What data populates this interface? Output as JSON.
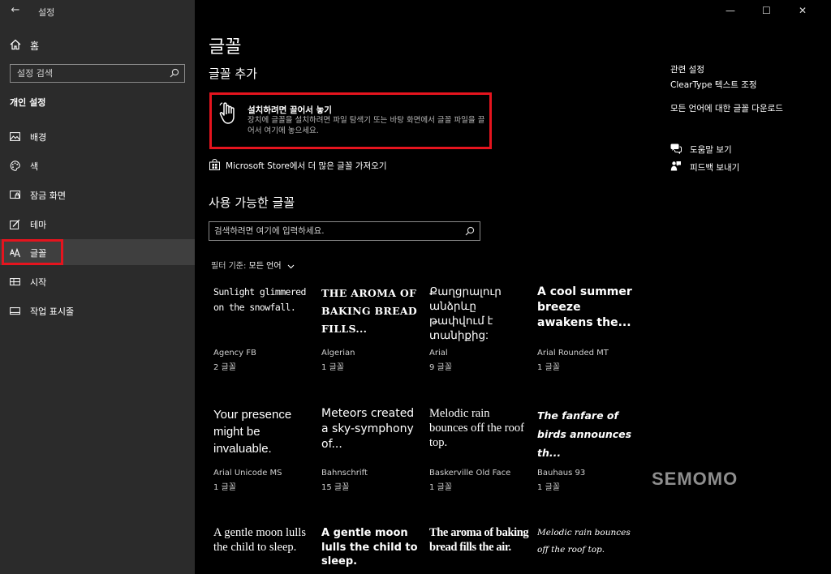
{
  "titlebar": {
    "title": "설정",
    "back_glyph": "←"
  },
  "sidebar": {
    "home_label": "홈",
    "search": {
      "placeholder": "설정 검색"
    },
    "section_title": "개인 설정",
    "items": [
      {
        "label": "배경",
        "icon": "image-icon"
      },
      {
        "label": "색",
        "icon": "palette-icon"
      },
      {
        "label": "잠금 화면",
        "icon": "lock-screen-icon"
      },
      {
        "label": "테마",
        "icon": "theme-icon"
      },
      {
        "label": "글꼴",
        "icon": "font-icon",
        "active": true
      },
      {
        "label": "시작",
        "icon": "start-icon"
      },
      {
        "label": "작업 표시줄",
        "icon": "taskbar-icon"
      }
    ]
  },
  "window_controls": {
    "minimize": "—",
    "maximize": "☐",
    "close": "✕"
  },
  "main": {
    "title": "글꼴",
    "add_fonts_heading": "글꼴 추가",
    "drop_zone": {
      "title": "설치하려면 끌어서 놓기",
      "description": "장치에 글꼴을 설치하려면 파일 탐색기 또는 바탕 화면에서 글꼴 파일을 끌어서 여기에 놓으세요."
    },
    "store_link": "Microsoft Store에서 더 많은 글꼴 가져오기",
    "available_heading": "사용 가능한 글꼴",
    "font_search": {
      "placeholder": "검색하려면 여기에 입력하세요."
    },
    "filter": {
      "label": "필터 기준:",
      "value": "모든 언어"
    },
    "fonts": [
      {
        "sample": "Sunlight glimmered on the snowfall.",
        "name": "Agency FB",
        "count": "2 글꼴"
      },
      {
        "sample": "THE AROMA OF BAKING BREAD FILLS...",
        "name": "Algerian",
        "count": "1 글꼴"
      },
      {
        "sample": "Քաղցրալուր անձրևը թափվում է տանիքից:",
        "name": "Arial",
        "count": "9 글꼴"
      },
      {
        "sample": "A cool summer breeze awakens the...",
        "name": "Arial Rounded MT",
        "count": "1 글꼴"
      },
      {
        "sample": "Your presence might be invaluable.",
        "name": "Arial Unicode MS",
        "count": "1 글꼴"
      },
      {
        "sample": "Meteors created a sky-symphony of...",
        "name": "Bahnschrift",
        "count": "15 글꼴"
      },
      {
        "sample": "Melodic rain bounces off the roof top.",
        "name": "Baskerville Old Face",
        "count": "1 글꼴"
      },
      {
        "sample": "The fanfare of birds announces th...",
        "name": "Bauhaus 93",
        "count": "1 글꼴"
      },
      {
        "sample": "A gentle moon lulls the child to sleep.",
        "name": "",
        "count": ""
      },
      {
        "sample": "A gentle moon lulls the child to sleep.",
        "name": "",
        "count": ""
      },
      {
        "sample": "The aroma of baking bread fills the air.",
        "name": "",
        "count": ""
      },
      {
        "sample": "Melodic rain bounces off the roof top.",
        "name": "",
        "count": ""
      }
    ]
  },
  "related": {
    "title": "관련 설정",
    "links": [
      "ClearType 텍스트 조정",
      "모든 언어에 대한 글꼴 다운로드"
    ],
    "help": [
      {
        "label": "도움말 보기",
        "icon": "help-chat-icon"
      },
      {
        "label": "피드백 보내기",
        "icon": "feedback-icon"
      }
    ]
  },
  "watermark": "SEMOMO",
  "colors": {
    "highlight_red": "#e5141e",
    "sidebar_bg": "#2b2b2b",
    "main_bg": "#000000"
  }
}
